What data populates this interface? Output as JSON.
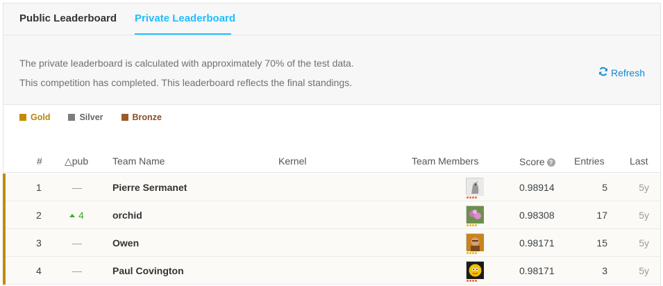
{
  "tabs": {
    "public": "Public Leaderboard",
    "private": "Private Leaderboard",
    "active": "private"
  },
  "info": {
    "line1": "The private leaderboard is calculated with approximately 70% of the test data.",
    "line2": "This competition has completed. This leaderboard reflects the final standings.",
    "refresh_label": "Refresh"
  },
  "legend": [
    {
      "label": "Gold",
      "color": "#c48a00",
      "text_color": "#b8860b"
    },
    {
      "label": "Silver",
      "color": "#7d7d7d",
      "text_color": "#666666"
    },
    {
      "label": "Bronze",
      "color": "#9a5a2b",
      "text_color": "#8a4f23"
    }
  ],
  "columns": {
    "rank": "#",
    "pub": "△pub",
    "team": "Team Name",
    "kernel": "Kernel",
    "members": "Team Members",
    "score": "Score",
    "entries": "Entries",
    "last": "Last"
  },
  "rows": [
    {
      "rank": "1",
      "delta": "—",
      "delta_dir": "none",
      "team": "Pierre Sermanet",
      "avatar": "gray",
      "score": "0.98914",
      "entries": "5",
      "last": "5y",
      "dot_color": "#e8663d"
    },
    {
      "rank": "2",
      "delta": "4",
      "delta_dir": "up",
      "team": "orchid",
      "avatar": "pink",
      "score": "0.98308",
      "entries": "17",
      "last": "5y",
      "dot_color": "#e6b800"
    },
    {
      "rank": "3",
      "delta": "—",
      "delta_dir": "none",
      "team": "Owen",
      "avatar": "brown",
      "score": "0.98171",
      "entries": "15",
      "last": "5y",
      "dot_color": "#e6b800"
    },
    {
      "rank": "4",
      "delta": "—",
      "delta_dir": "none",
      "team": "Paul Covington",
      "avatar": "yellow",
      "score": "0.98171",
      "entries": "3",
      "last": "5y",
      "dot_color": "#e8663d"
    }
  ]
}
